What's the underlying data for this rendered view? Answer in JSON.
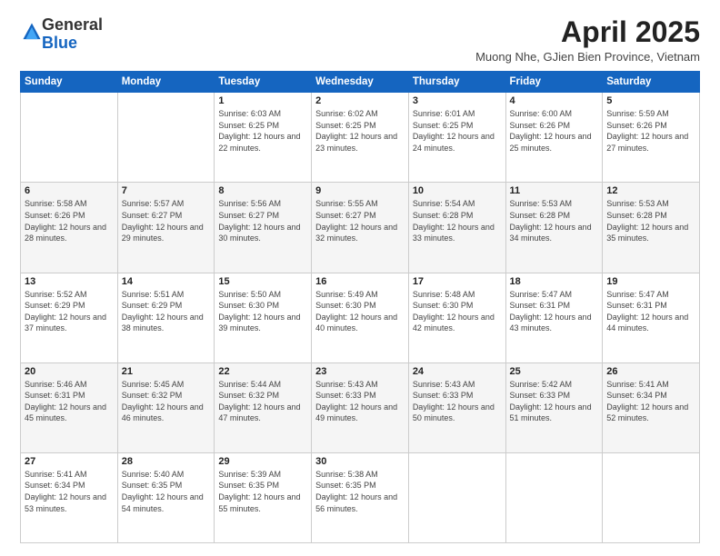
{
  "logo": {
    "general": "General",
    "blue": "Blue"
  },
  "header": {
    "month": "April 2025",
    "location": "Muong Nhe, GJien Bien Province, Vietnam"
  },
  "days_of_week": [
    "Sunday",
    "Monday",
    "Tuesday",
    "Wednesday",
    "Thursday",
    "Friday",
    "Saturday"
  ],
  "weeks": [
    [
      {
        "day": "",
        "info": ""
      },
      {
        "day": "",
        "info": ""
      },
      {
        "day": "1",
        "info": "Sunrise: 6:03 AM\nSunset: 6:25 PM\nDaylight: 12 hours and 22 minutes."
      },
      {
        "day": "2",
        "info": "Sunrise: 6:02 AM\nSunset: 6:25 PM\nDaylight: 12 hours and 23 minutes."
      },
      {
        "day": "3",
        "info": "Sunrise: 6:01 AM\nSunset: 6:25 PM\nDaylight: 12 hours and 24 minutes."
      },
      {
        "day": "4",
        "info": "Sunrise: 6:00 AM\nSunset: 6:26 PM\nDaylight: 12 hours and 25 minutes."
      },
      {
        "day": "5",
        "info": "Sunrise: 5:59 AM\nSunset: 6:26 PM\nDaylight: 12 hours and 27 minutes."
      }
    ],
    [
      {
        "day": "6",
        "info": "Sunrise: 5:58 AM\nSunset: 6:26 PM\nDaylight: 12 hours and 28 minutes."
      },
      {
        "day": "7",
        "info": "Sunrise: 5:57 AM\nSunset: 6:27 PM\nDaylight: 12 hours and 29 minutes."
      },
      {
        "day": "8",
        "info": "Sunrise: 5:56 AM\nSunset: 6:27 PM\nDaylight: 12 hours and 30 minutes."
      },
      {
        "day": "9",
        "info": "Sunrise: 5:55 AM\nSunset: 6:27 PM\nDaylight: 12 hours and 32 minutes."
      },
      {
        "day": "10",
        "info": "Sunrise: 5:54 AM\nSunset: 6:28 PM\nDaylight: 12 hours and 33 minutes."
      },
      {
        "day": "11",
        "info": "Sunrise: 5:53 AM\nSunset: 6:28 PM\nDaylight: 12 hours and 34 minutes."
      },
      {
        "day": "12",
        "info": "Sunrise: 5:53 AM\nSunset: 6:28 PM\nDaylight: 12 hours and 35 minutes."
      }
    ],
    [
      {
        "day": "13",
        "info": "Sunrise: 5:52 AM\nSunset: 6:29 PM\nDaylight: 12 hours and 37 minutes."
      },
      {
        "day": "14",
        "info": "Sunrise: 5:51 AM\nSunset: 6:29 PM\nDaylight: 12 hours and 38 minutes."
      },
      {
        "day": "15",
        "info": "Sunrise: 5:50 AM\nSunset: 6:30 PM\nDaylight: 12 hours and 39 minutes."
      },
      {
        "day": "16",
        "info": "Sunrise: 5:49 AM\nSunset: 6:30 PM\nDaylight: 12 hours and 40 minutes."
      },
      {
        "day": "17",
        "info": "Sunrise: 5:48 AM\nSunset: 6:30 PM\nDaylight: 12 hours and 42 minutes."
      },
      {
        "day": "18",
        "info": "Sunrise: 5:47 AM\nSunset: 6:31 PM\nDaylight: 12 hours and 43 minutes."
      },
      {
        "day": "19",
        "info": "Sunrise: 5:47 AM\nSunset: 6:31 PM\nDaylight: 12 hours and 44 minutes."
      }
    ],
    [
      {
        "day": "20",
        "info": "Sunrise: 5:46 AM\nSunset: 6:31 PM\nDaylight: 12 hours and 45 minutes."
      },
      {
        "day": "21",
        "info": "Sunrise: 5:45 AM\nSunset: 6:32 PM\nDaylight: 12 hours and 46 minutes."
      },
      {
        "day": "22",
        "info": "Sunrise: 5:44 AM\nSunset: 6:32 PM\nDaylight: 12 hours and 47 minutes."
      },
      {
        "day": "23",
        "info": "Sunrise: 5:43 AM\nSunset: 6:33 PM\nDaylight: 12 hours and 49 minutes."
      },
      {
        "day": "24",
        "info": "Sunrise: 5:43 AM\nSunset: 6:33 PM\nDaylight: 12 hours and 50 minutes."
      },
      {
        "day": "25",
        "info": "Sunrise: 5:42 AM\nSunset: 6:33 PM\nDaylight: 12 hours and 51 minutes."
      },
      {
        "day": "26",
        "info": "Sunrise: 5:41 AM\nSunset: 6:34 PM\nDaylight: 12 hours and 52 minutes."
      }
    ],
    [
      {
        "day": "27",
        "info": "Sunrise: 5:41 AM\nSunset: 6:34 PM\nDaylight: 12 hours and 53 minutes."
      },
      {
        "day": "28",
        "info": "Sunrise: 5:40 AM\nSunset: 6:35 PM\nDaylight: 12 hours and 54 minutes."
      },
      {
        "day": "29",
        "info": "Sunrise: 5:39 AM\nSunset: 6:35 PM\nDaylight: 12 hours and 55 minutes."
      },
      {
        "day": "30",
        "info": "Sunrise: 5:38 AM\nSunset: 6:35 PM\nDaylight: 12 hours and 56 minutes."
      },
      {
        "day": "",
        "info": ""
      },
      {
        "day": "",
        "info": ""
      },
      {
        "day": "",
        "info": ""
      }
    ]
  ]
}
